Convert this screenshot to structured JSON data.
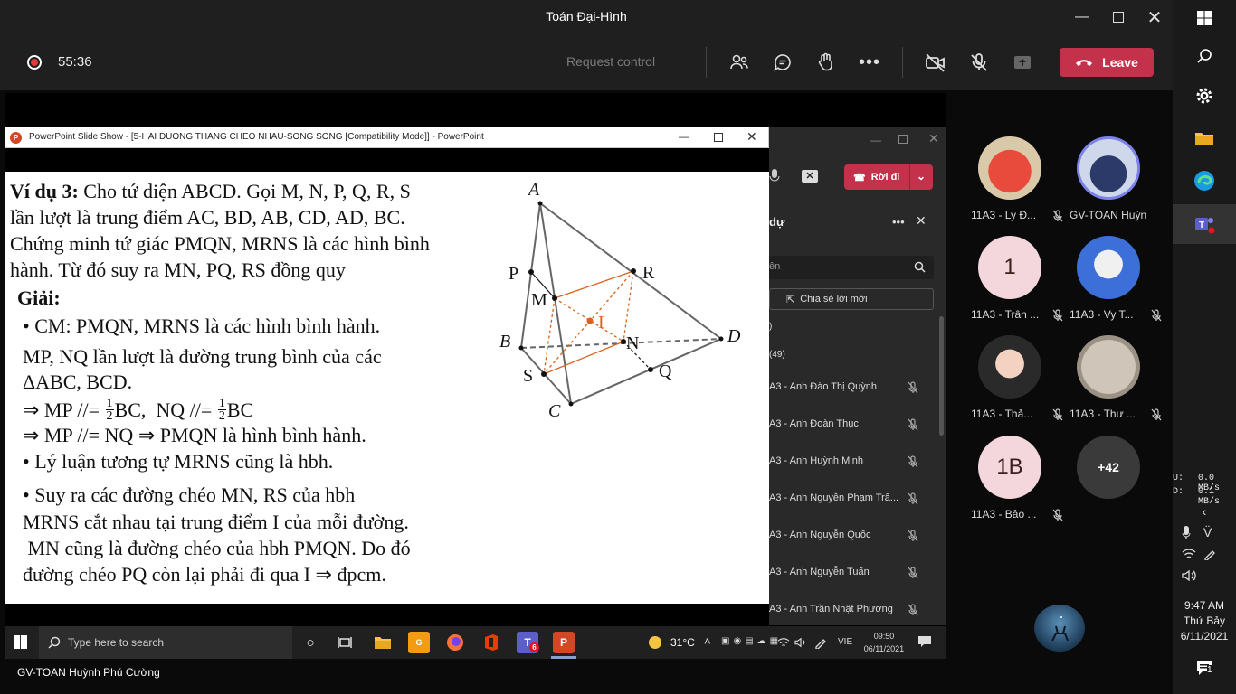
{
  "window": {
    "title": "Toán Đại-Hình"
  },
  "meeting": {
    "elapsed": "55:36",
    "request_control": "Request control",
    "leave_label": "Leave"
  },
  "ppt": {
    "title": "PowerPoint Slide Show - [5-HAI DUONG THANG CHEO NHAU-SONG SONG [Compatibility Mode]] - PowerPoint"
  },
  "slide": {
    "lines": [
      "Cho tứ diện ABCD. Gọi M, N, P, Q, R, S",
      "lần lượt là trung điểm AC, BD, AB, CD, AD, BC.",
      "Chứng minh tứ giác PMQN, MRNS là các hình bình",
      "hành. Từ đó suy ra MN, PQ, RS đồng quy"
    ],
    "example_label": "Ví dụ 3:",
    "solution_label": "Giải:",
    "b1": "• CM: PMQN, MRNS là các hình bình hành.",
    "b2": "MP, NQ lần lượt là đường trung bình của các",
    "b3": "ΔABC, BCD.",
    "b4a": "⇒ MP //= ",
    "b4b": "BC,  NQ //= ",
    "b4c": "BC",
    "frac_num": "1",
    "frac_den": "2",
    "b5": "⇒ MP //= NQ ⇒ PMQN là hình bình hành.",
    "b6": "• Lý luận tương tự MRNS cũng là hbh.",
    "b7": "• Suy ra các đường chéo MN, RS của hbh",
    "b8": "MRNS cắt nhau tại trung điểm I của mỗi đường.",
    "b9": " MN cũng là đường chéo của hbh PMQN. Do đó",
    "b10": "đường chéo PQ còn lại phải đi qua I ⇒ đpcm.",
    "points": {
      "A": "A",
      "B": "B",
      "C": "C",
      "D": "D",
      "P": "P",
      "M": "M",
      "R": "R",
      "I": "I",
      "N": "N",
      "S": "S",
      "Q": "Q"
    }
  },
  "teams_panel": {
    "leave_label": "Rời đi",
    "search_placeholder": "ên",
    "share_invite": "Chia sẻ lời mời",
    "section_a": ")",
    "section_b": "(49)",
    "participants": [
      "A3 - Anh Đào Thị Quỳnh",
      "A3 - Anh Đoàn Thục",
      "A3 - Anh Huỳnh Minh",
      "A3 - Anh Nguyễn Phạm Trâ...",
      "A3 - Anh Nguyễn Quốc",
      "A3 - Anh Nguyễn Tuấn",
      "A3 - Anh Trần Nhật Phương"
    ]
  },
  "taskbar": {
    "search_placeholder": "Type here to search",
    "weather": "31°C",
    "lang": "VIE",
    "time": "09:50",
    "date": "06/11/2021",
    "teams_badge": "6"
  },
  "presenter": "GV-TOAN Huỳnh Phú Cường",
  "gallery": [
    {
      "name": "11A3 - Ly Đ...",
      "initials": "",
      "muted": true
    },
    {
      "name": "GV-TOAN Huỳn...",
      "initials": "",
      "muted": false
    },
    {
      "name": "11A3 - Trân ...",
      "initials": "1",
      "muted": true
    },
    {
      "name": "11A3 - Vy T...",
      "initials": "",
      "muted": true
    },
    {
      "name": "11A3 - Thả...",
      "initials": "",
      "muted": true
    },
    {
      "name": "11A3 - Thư ...",
      "initials": "",
      "muted": true
    },
    {
      "name": "11A3 - Bảo ...",
      "initials": "1B",
      "muted": true
    },
    {
      "name": "",
      "initials": "+42",
      "muted": false
    }
  ],
  "system": {
    "up_label": "U:",
    "up": "0.0 MB/s",
    "down_label": "D:",
    "down": "0.1 MB/s",
    "clock_time": "9:47 AM",
    "clock_day": "Thứ Bảy",
    "clock_date": "6/11/2021",
    "notif_count": "1"
  },
  "colors": {
    "leave": "#c4314b",
    "accent_orange": "#d9621b",
    "bg": "#1f1f1f"
  }
}
